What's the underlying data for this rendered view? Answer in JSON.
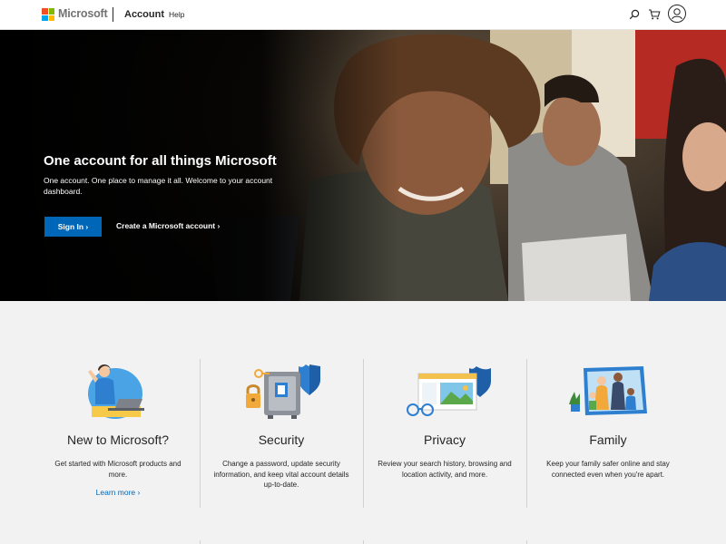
{
  "header": {
    "brand": "Microsoft",
    "account_link": "Account",
    "help_link": "Help",
    "icons": [
      "search-icon",
      "cart-icon",
      "user-avatar-icon"
    ]
  },
  "hero": {
    "title": "One account for all things Microsoft",
    "subtitle": "One account. One place to manage it all. Welcome to your account dashboard.",
    "signin_label": "Sign In ›",
    "create_label": "Create a Microsoft account ›"
  },
  "cards": [
    {
      "title": "New to Microsoft?",
      "description": "Get started with Microsoft products and more.",
      "link": "Learn more ›"
    },
    {
      "title": "Security",
      "description": "Change a password, update security information, and keep vital account details up-to-date."
    },
    {
      "title": "Privacy",
      "description": "Review your search history, browsing and location activity, and more."
    },
    {
      "title": "Family",
      "description": "Keep your family safer online and stay connected even when you're apart."
    }
  ],
  "colors": {
    "accent": "#0067b8",
    "logo_red": "#f25022",
    "logo_green": "#7fba00",
    "logo_blue": "#00a4ef",
    "logo_yellow": "#ffb900",
    "page_bg": "#f2f2f2"
  }
}
